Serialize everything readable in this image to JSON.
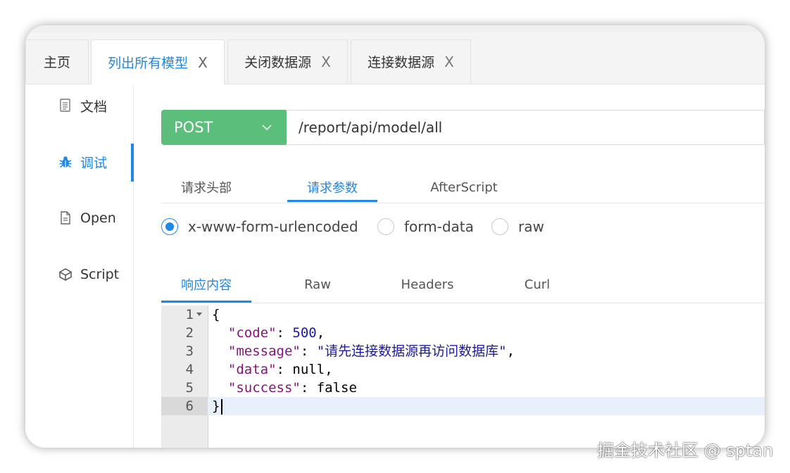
{
  "tabs": [
    {
      "label": "主页",
      "closable": false,
      "active": false
    },
    {
      "label": "列出所有模型",
      "closable": true,
      "active": true
    },
    {
      "label": "关闭数据源",
      "closable": true,
      "active": false
    },
    {
      "label": "连接数据源",
      "closable": true,
      "active": false
    }
  ],
  "close_glyph": "X",
  "sidebar": {
    "items": [
      {
        "label": "文档",
        "icon": "document-icon",
        "active": false
      },
      {
        "label": "调试",
        "icon": "bug-icon",
        "active": true
      },
      {
        "label": "Open",
        "icon": "file-icon",
        "active": false
      },
      {
        "label": "Script",
        "icon": "cube-icon",
        "active": false
      }
    ]
  },
  "request": {
    "method": "POST",
    "url": "/report/api/model/all",
    "tabs": [
      "请求头部",
      "请求参数",
      "AfterScript"
    ],
    "active_tab": "请求参数",
    "body_types": [
      "x-www-form-urlencoded",
      "form-data",
      "raw"
    ],
    "selected_body_type": "x-www-form-urlencoded"
  },
  "response": {
    "tabs": [
      "响应内容",
      "Raw",
      "Headers",
      "Curl"
    ],
    "active_tab": "响应内容",
    "lines": [
      {
        "num": "1",
        "text": "{"
      },
      {
        "num": "2",
        "key": "\"code\"",
        "sep": ": ",
        "val": "500",
        "end": ","
      },
      {
        "num": "3",
        "key": "\"message\"",
        "sep": ": ",
        "val": "\"请先连接数据源再访问数据库\"",
        "end": ","
      },
      {
        "num": "4",
        "key": "\"data\"",
        "sep": ": ",
        "val": "null",
        "end": ","
      },
      {
        "num": "5",
        "key": "\"success\"",
        "sep": ": ",
        "val": "false",
        "end": ""
      },
      {
        "num": "6",
        "text": "}"
      }
    ]
  },
  "watermark": "掘金技术社区 @ sptan",
  "colors": {
    "accent": "#1e88e5",
    "method_bg": "#5bbf7b"
  }
}
